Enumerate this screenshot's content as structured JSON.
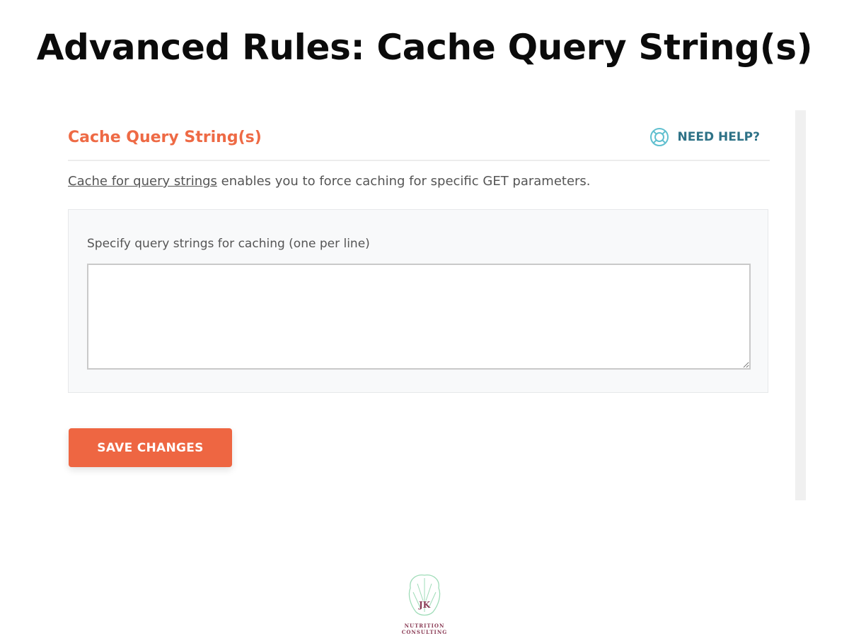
{
  "page": {
    "title": "Advanced Rules: Cache Query String(s)"
  },
  "panel": {
    "title": "Cache Query String(s)",
    "help_label": "NEED HELP?",
    "help_icon": "lifebuoy-icon",
    "description_link": "Cache for query strings",
    "description_rest": " enables you to force caching for specific GET parameters.",
    "field_label": "Specify query strings for caching (one per line)",
    "field_value": "",
    "save_label": "SAVE CHANGES"
  },
  "colors": {
    "accent": "#ee6642",
    "help": "#2e7287"
  },
  "logo": {
    "initials": "JK",
    "line1": "NUTRITION",
    "line2": "CONSULTING"
  }
}
